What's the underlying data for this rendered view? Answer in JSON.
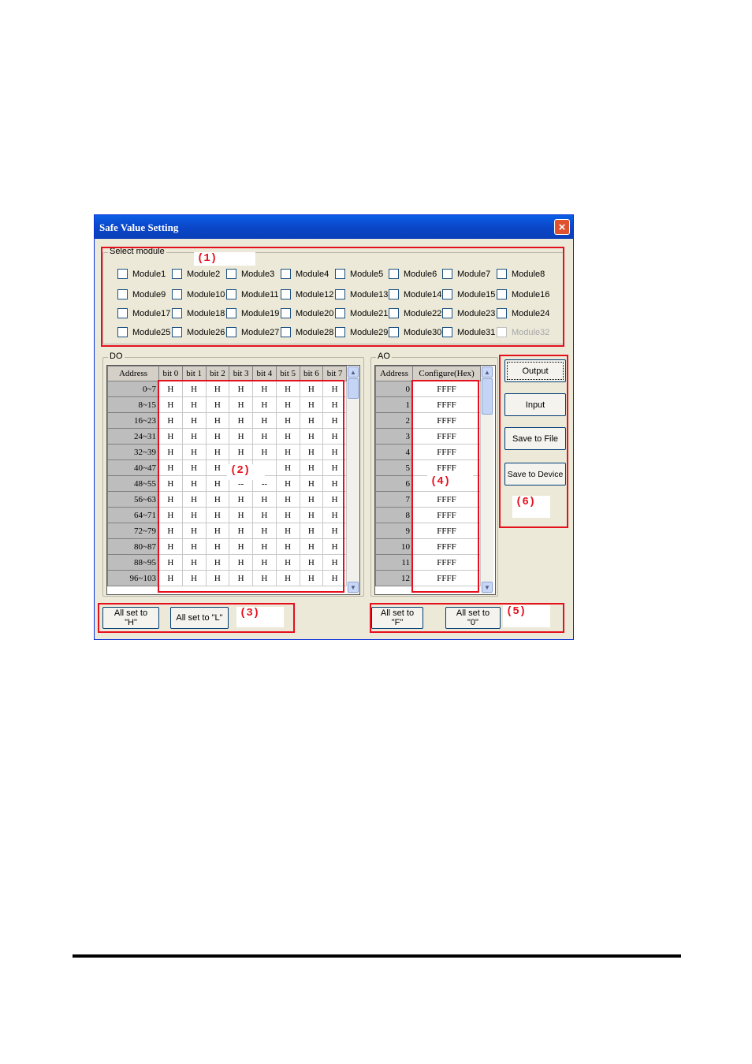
{
  "window": {
    "title": "Safe Value Setting",
    "close_glyph": "×"
  },
  "select_module": {
    "label": "Select module",
    "modules": [
      "Module1",
      "Module2",
      "Module3",
      "Module4",
      "Module5",
      "Module6",
      "Module7",
      "Module8",
      "Module9",
      "Module10",
      "Module11",
      "Module12",
      "Module13",
      "Module14",
      "Module15",
      "Module16",
      "Module17",
      "Module18",
      "Module19",
      "Module20",
      "Module21",
      "Module22",
      "Module23",
      "Module24",
      "Module25",
      "Module26",
      "Module27",
      "Module28",
      "Module29",
      "Module30",
      "Module31",
      "Module32"
    ],
    "disabled": [
      "Module32"
    ]
  },
  "do_group": {
    "label": "DO",
    "headers": [
      "Address",
      "bit 0",
      "bit 1",
      "bit 2",
      "bit 3",
      "bit 4",
      "bit 5",
      "bit 6",
      "bit 7"
    ],
    "rows": [
      [
        "0~7",
        "H",
        "H",
        "H",
        "H",
        "H",
        "H",
        "H",
        "H"
      ],
      [
        "8~15",
        "H",
        "H",
        "H",
        "H",
        "H",
        "H",
        "H",
        "H"
      ],
      [
        "16~23",
        "H",
        "H",
        "H",
        "H",
        "H",
        "H",
        "H",
        "H"
      ],
      [
        "24~31",
        "H",
        "H",
        "H",
        "H",
        "H",
        "H",
        "H",
        "H"
      ],
      [
        "32~39",
        "H",
        "H",
        "H",
        "H",
        "H",
        "H",
        "H",
        "H"
      ],
      [
        "40~47",
        "H",
        "H",
        "H",
        "",
        "",
        "H",
        "H",
        "H"
      ],
      [
        "48~55",
        "H",
        "H",
        "H",
        "--",
        "--",
        "H",
        "H",
        "H"
      ],
      [
        "56~63",
        "H",
        "H",
        "H",
        "H",
        "H",
        "H",
        "H",
        "H"
      ],
      [
        "64~71",
        "H",
        "H",
        "H",
        "H",
        "H",
        "H",
        "H",
        "H"
      ],
      [
        "72~79",
        "H",
        "H",
        "H",
        "H",
        "H",
        "H",
        "H",
        "H"
      ],
      [
        "80~87",
        "H",
        "H",
        "H",
        "H",
        "H",
        "H",
        "H",
        "H"
      ],
      [
        "88~95",
        "H",
        "H",
        "H",
        "H",
        "H",
        "H",
        "H",
        "H"
      ],
      [
        "96~103",
        "H",
        "H",
        "H",
        "H",
        "H",
        "H",
        "H",
        "H"
      ]
    ],
    "btn_all_h": "All set to \"H\"",
    "btn_all_l": "All set to \"L\""
  },
  "ao_group": {
    "label": "AO",
    "headers": [
      "Address",
      "Configure(Hex)"
    ],
    "rows": [
      [
        "0",
        "FFFF"
      ],
      [
        "1",
        "FFFF"
      ],
      [
        "2",
        "FFFF"
      ],
      [
        "3",
        "FFFF"
      ],
      [
        "4",
        "FFFF"
      ],
      [
        "5",
        "FFFF"
      ],
      [
        "6",
        ""
      ],
      [
        "7",
        "FFFF"
      ],
      [
        "8",
        "FFFF"
      ],
      [
        "9",
        "FFFF"
      ],
      [
        "10",
        "FFFF"
      ],
      [
        "11",
        "FFFF"
      ],
      [
        "12",
        "FFFF"
      ]
    ],
    "btn_all_f": "All set to \"F\"",
    "btn_all_0": "All set to \"0\""
  },
  "actions": {
    "output": "Output",
    "input": "Input",
    "save_file": "Save to File",
    "save_device": "Save to Device"
  },
  "markers": [
    "(1)",
    "(2)",
    "(3)",
    "(4)",
    "(5)",
    "(6)"
  ],
  "colors": {
    "annotation": "#e5101d",
    "title_bar": "#0b47c9"
  }
}
